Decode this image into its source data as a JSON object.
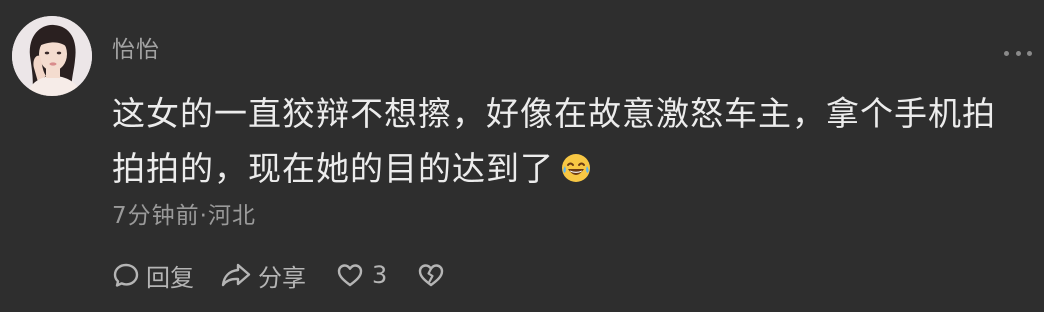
{
  "comment": {
    "username": "怡怡",
    "text": "这女的一直狡辩不想擦，好像在故意激怒车主，拿个手机拍拍拍的，现在她的目的达到了",
    "emoji_icon": "laughing-tears-emoji",
    "meta": "7分钟前·河北",
    "actions": {
      "reply_label": "回复",
      "share_label": "分享",
      "like_count": "3"
    }
  },
  "icons": {
    "avatar": "user-avatar-photo",
    "more": "more-dots-icon",
    "reply": "comment-bubble-icon",
    "share": "share-arrow-icon",
    "like": "heart-icon",
    "dislike": "broken-heart-icon"
  },
  "colors": {
    "background": "#2e2e2e",
    "text": "#ececec",
    "secondary": "#a3a3a3"
  }
}
